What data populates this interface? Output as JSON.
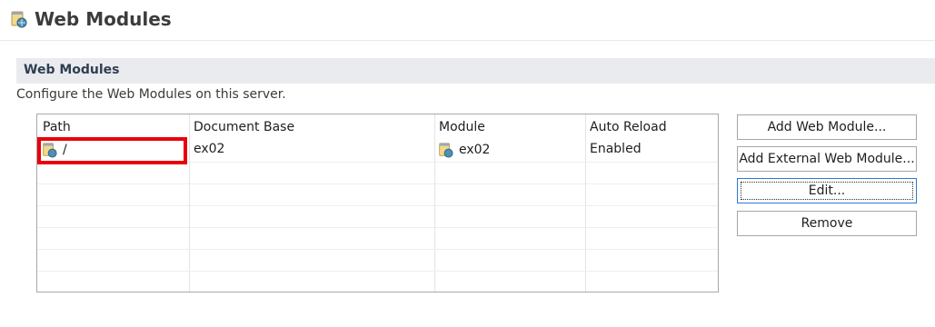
{
  "header": {
    "title": "Web Modules",
    "icon": "web-module-icon"
  },
  "section": {
    "title": "Web Modules",
    "description": "Configure the Web Modules on this server."
  },
  "table": {
    "columns": [
      "Path",
      "Document Base",
      "Module",
      "Auto Reload"
    ],
    "rows": [
      {
        "path": "/",
        "document_base": "ex02",
        "module": "ex02",
        "auto_reload": "Enabled"
      }
    ]
  },
  "buttons": {
    "add": "Add Web Module...",
    "add_external": "Add External Web Module...",
    "edit": "Edit...",
    "remove": "Remove"
  },
  "colors": {
    "highlight": "#e8000b",
    "section_bg": "#e9ebee"
  }
}
